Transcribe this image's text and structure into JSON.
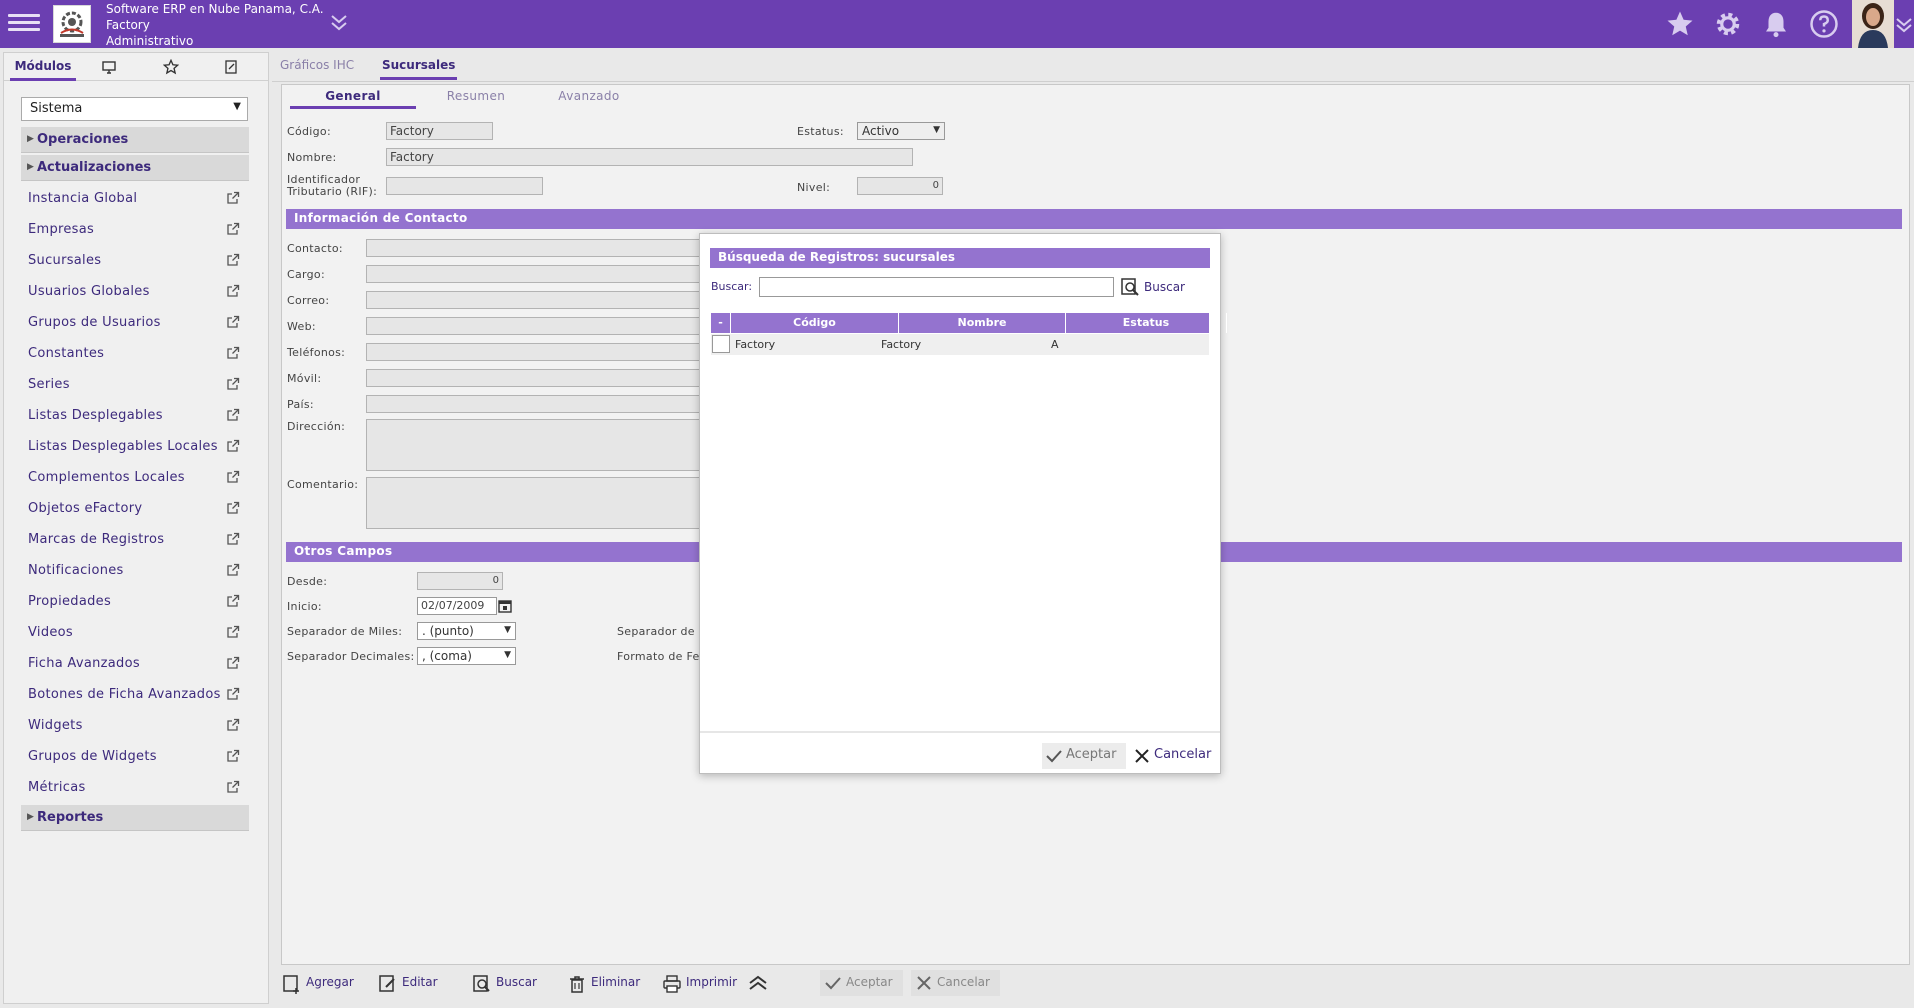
{
  "header": {
    "company": "Software ERP en Nube Panama, C.A.",
    "branch": "Factory",
    "role": "Administrativo"
  },
  "sidebar": {
    "tabs": {
      "modules": "Módulos"
    },
    "module_select": "Sistema",
    "groups": {
      "operations": "Operaciones",
      "updates": "Actualizaciones",
      "reports": "Reportes"
    },
    "items": [
      "Instancia Global",
      "Empresas",
      "Sucursales",
      "Usuarios Globales",
      "Grupos de Usuarios",
      "Constantes",
      "Series",
      "Listas Desplegables",
      "Listas Desplegables Locales",
      "Complementos Locales",
      "Objetos eFactory",
      "Marcas de Registros",
      "Notificaciones",
      "Propiedades",
      "Videos",
      "Ficha Avanzados",
      "Botones de Ficha Avanzados",
      "Widgets",
      "Grupos de Widgets",
      "Métricas"
    ]
  },
  "main_tabs": [
    "Gráficos IHC",
    "Sucursales"
  ],
  "sub_tabs": [
    "General",
    "Resumen",
    "Avanzado"
  ],
  "form": {
    "code_label": "Código:",
    "code_value": "Factory",
    "name_label": "Nombre:",
    "name_value": "Factory",
    "tax_id_label_1": "Identificador",
    "tax_id_label_2": "Tributario (RIF):",
    "status_label": "Estatus:",
    "status_value": "Activo",
    "level_label": "Nivel:",
    "level_value": "0"
  },
  "contact_section": {
    "title": "Información de Contacto",
    "labels": [
      "Contacto:",
      "Cargo:",
      "Correo:",
      "Web:",
      "Teléfonos:",
      "Móvil:",
      "País:",
      "Dirección:",
      "Comentario:"
    ]
  },
  "other_section": {
    "title": "Otros Campos",
    "from_label": "Desde:",
    "from_value": "0",
    "start_label": "Inicio:",
    "start_value": "02/07/2009",
    "thousands_label": "Separador de Miles:",
    "thousands_value": ". (punto)",
    "decimals_label": "Separador Decimales:",
    "decimals_value": ", (coma)",
    "right_sep_label": "Separador de",
    "right_format_label": "Formato de Fe"
  },
  "toolbar": {
    "add": "Agregar",
    "edit": "Editar",
    "search": "Buscar",
    "delete": "Eliminar",
    "print": "Imprimir",
    "accept": "Aceptar",
    "cancel": "Cancelar"
  },
  "modal": {
    "title": "Búsqueda de Registros: sucursales",
    "search_label": "Buscar:",
    "search_value": "",
    "search_button": "Buscar",
    "columns": [
      "-",
      "Código",
      "Nombre",
      "Estatus"
    ],
    "rows": [
      {
        "code": "Factory",
        "name": "Factory",
        "status": "A"
      }
    ],
    "accept": "Aceptar",
    "cancel": "Cancelar"
  }
}
